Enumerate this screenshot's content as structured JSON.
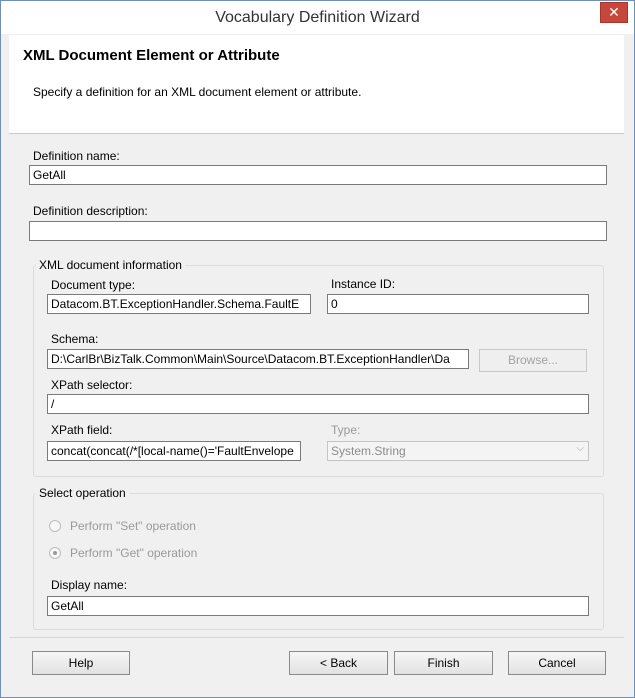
{
  "window": {
    "title": "Vocabulary Definition Wizard",
    "close_glyph": "✕"
  },
  "header": {
    "title": "XML Document Element or Attribute",
    "subtitle": "Specify a definition for an XML document element or attribute."
  },
  "form": {
    "definition_name_label": "Definition name:",
    "definition_name_value": "GetAll",
    "definition_description_label": "Definition description:",
    "definition_description_value": ""
  },
  "xml_info": {
    "caption": "XML document information",
    "document_type_label": "Document type:",
    "document_type_value": "Datacom.BT.ExceptionHandler.Schema.FaultE",
    "instance_id_label": "Instance ID:",
    "instance_id_value": "0",
    "schema_label": "Schema:",
    "schema_value": "D:\\CarlBr\\BizTalk.Common\\Main\\Source\\Datacom.BT.ExceptionHandler\\Da",
    "browse_label": "Browse...",
    "xpath_selector_label": "XPath selector:",
    "xpath_selector_value": "/",
    "xpath_field_label": "XPath field:",
    "xpath_field_value": "concat(concat(/*[local-name()='FaultEnvelope",
    "type_label": "Type:",
    "type_value": "System.String"
  },
  "operation": {
    "caption": "Select operation",
    "set_label": "Perform \"Set\" operation",
    "get_label": "Perform \"Get\" operation",
    "selected": "get",
    "display_name_label": "Display name:",
    "display_name_value": "GetAll"
  },
  "buttons": {
    "help": "Help",
    "back": "< Back",
    "finish": "Finish",
    "cancel": "Cancel"
  },
  "icons": {
    "dropdown": "chevron-down-icon"
  },
  "colors": {
    "close_button": "#c7473a",
    "window_border": "#6f8fb5"
  }
}
